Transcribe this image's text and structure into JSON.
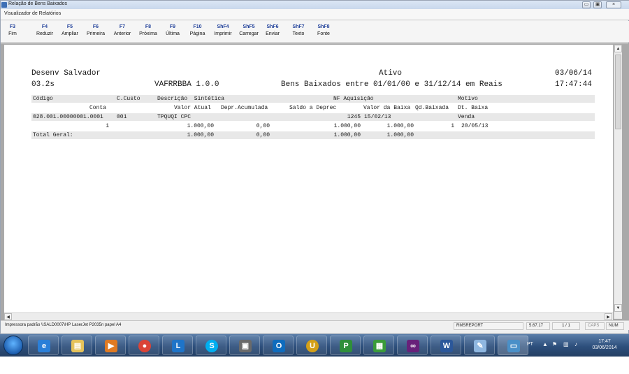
{
  "window": {
    "title": "Relação de Bens Baixados",
    "subtitle": "Visualizador de Relatórios"
  },
  "toolbar": {
    "buttons": [
      {
        "key": "F3",
        "label": "Fim"
      },
      {
        "key": "F4",
        "label": "Reduzir"
      },
      {
        "key": "F5",
        "label": "Ampliar"
      },
      {
        "key": "F6",
        "label": "Primeira"
      },
      {
        "key": "F7",
        "label": "Anterior"
      },
      {
        "key": "F8",
        "label": "Próxima"
      },
      {
        "key": "F9",
        "label": "Última"
      },
      {
        "key": "F10",
        "label": "Página"
      },
      {
        "key": "ShF4",
        "label": "Imprimir"
      },
      {
        "key": "ShF5",
        "label": "Carregar"
      },
      {
        "key": "ShF6",
        "label": "Enviar"
      },
      {
        "key": "ShF7",
        "label": "Texto"
      },
      {
        "key": "ShF8",
        "label": "Fonte"
      }
    ]
  },
  "report": {
    "company": "Desenv Salvador",
    "version_left": "03.2s",
    "program": "VAFRRBBA 1.0.0",
    "heading": "Ativo",
    "period": "Bens Baixados entre 01/01/00 e 31/12/14 em Reais",
    "date": "03/06/14",
    "time": "17:47:44",
    "columns1": {
      "codigo": "Código",
      "ccusto": "C.Custo",
      "descricao": "Descrição  Sintética",
      "nf": "NF Aquisição",
      "motivo": "Motivo"
    },
    "columns2": {
      "conta": "Conta",
      "valor_atual": "Valor Atual",
      "depr": "Depr.Acumulada",
      "saldo": "Saldo a Deprec",
      "valor_baixa": "Valor da Baixa",
      "qd": "Qd.Baixada",
      "dt": "Dt. Baixa"
    },
    "item": {
      "codigo": "028.001.00000001.0001",
      "ccusto": "001",
      "descricao": "TPQUQI CPC",
      "nf": "1245",
      "aquisicao": "15/02/13",
      "motivo": "Venda",
      "conta": "1",
      "valor_atual": "1.000,00",
      "depr": "0,00",
      "saldo": "1.000,00",
      "valor_baixa": "1.000,00",
      "qd": "1",
      "dt": "20/05/13"
    },
    "total": {
      "label": "Total Geral:",
      "valor_atual": "1.000,00",
      "depr": "0,00",
      "saldo": "1.000,00",
      "valor_baixa": "1.000,00"
    }
  },
  "status": {
    "printer": "Impressora padrão \\\\SALD0007\\HP LaserJet P2035n papel A4",
    "module": "RMSREPORT",
    "version": "5.67.17",
    "page": "1 / 1",
    "caps": "CAPS",
    "num": "NUM"
  },
  "taskbar": {
    "lang": "PT",
    "time": "17:47",
    "date": "03/06/2014"
  }
}
